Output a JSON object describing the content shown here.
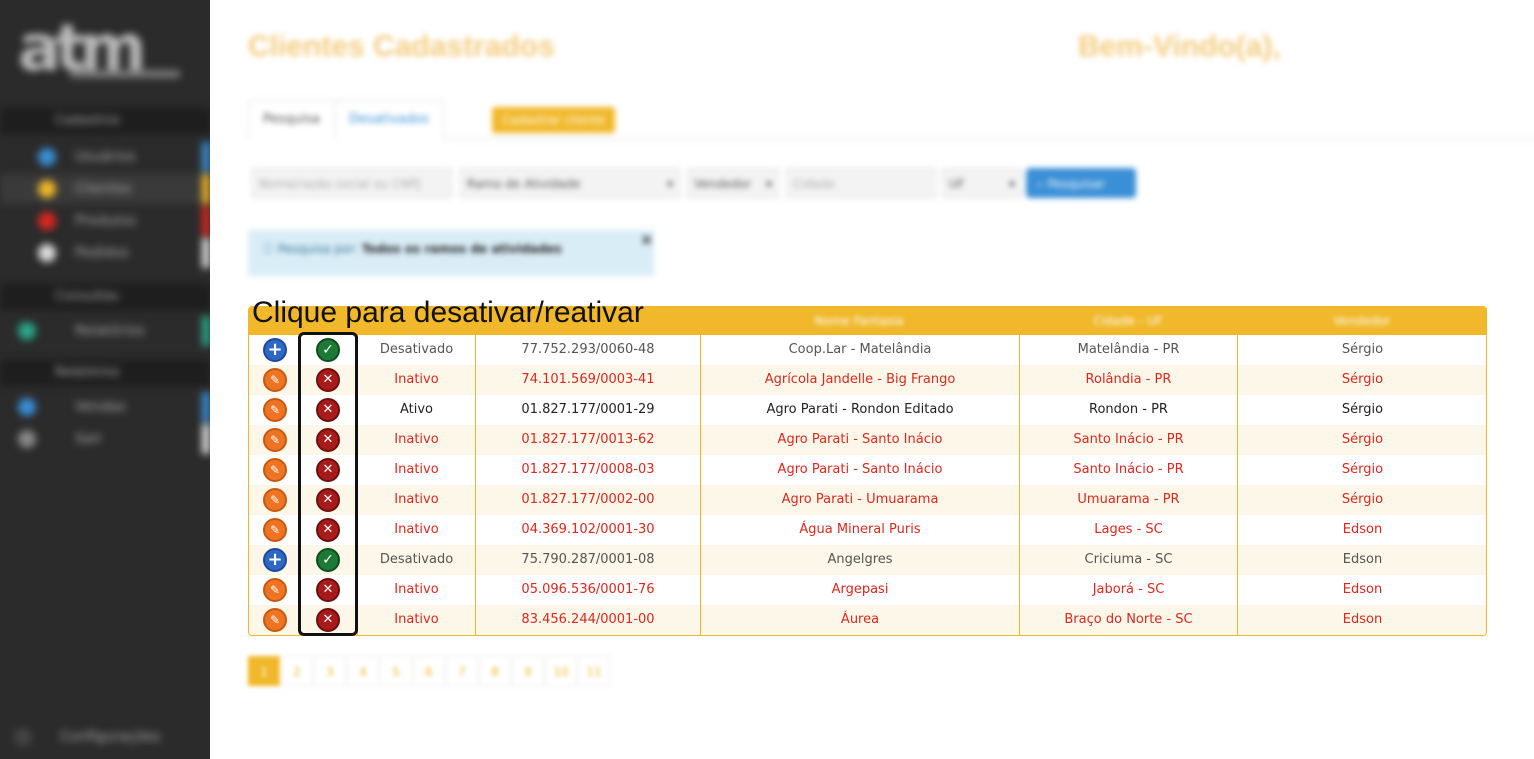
{
  "sidebar": {
    "logo": "atm",
    "sections": [
      "Cadastros",
      "Consultas",
      "Relatórios"
    ],
    "items": [
      {
        "label": "Usuários",
        "color": "#3a8fd6"
      },
      {
        "label": "Clientes",
        "color": "#f0b82a"
      },
      {
        "label": "Produtos",
        "color": "#d9281e"
      },
      {
        "label": "Pedidos",
        "color": "#dddddd"
      },
      {
        "label": "Relatórios",
        "color": "#2aa88a"
      },
      {
        "label": "Vendas",
        "color": "#3a8fd6"
      },
      {
        "label": "Sair",
        "color": "#888888"
      }
    ],
    "footer": "Configurações"
  },
  "header": {
    "title": "Clientes Cadastrados",
    "welcome": "Bem-Vindo(a),"
  },
  "tabs": {
    "search": "Pesquisa",
    "disabled": "Desativados",
    "register_button": "Cadastrar cliente"
  },
  "filters": {
    "name_placeholder": "Nome/razão social ou CNPJ",
    "activity": "Ramo de Atividade",
    "seller": "Vendedor",
    "city_placeholder": "Cidade",
    "uf": "UF",
    "search_button": "Pesquisar"
  },
  "alert": {
    "prefix": "Pesquisa por:",
    "text": "Todos os ramos de atividades",
    "close": "×"
  },
  "annotation": "Clique para desativar/reativar",
  "table": {
    "columns": [
      "Nome Fantasia",
      "Cidade - UF",
      "Vendedor"
    ],
    "rows": [
      {
        "action": "plus",
        "toggle": "check",
        "status": "Desativado",
        "cnpj": "77.752.293/0060-48",
        "name": "Coop.Lar - Matelândia",
        "city": "Matelândia - PR",
        "seller": "Sérgio",
        "tone": "gray"
      },
      {
        "action": "edit",
        "toggle": "x",
        "status": "Inativo",
        "cnpj": "74.101.569/0003-41",
        "name": "Agrícola Jandelle - Big Frango",
        "city": "Rolândia - PR",
        "seller": "Sérgio",
        "tone": "red"
      },
      {
        "action": "edit",
        "toggle": "x",
        "status": "Ativo",
        "cnpj": "01.827.177/0001-29",
        "name": "Agro Parati - Rondon Editado",
        "city": "Rondon - PR",
        "seller": "Sérgio",
        "tone": "dark"
      },
      {
        "action": "edit",
        "toggle": "x",
        "status": "Inativo",
        "cnpj": "01.827.177/0013-62",
        "name": "Agro Parati - Santo Inácio",
        "city": "Santo Inácio - PR",
        "seller": "Sérgio",
        "tone": "red"
      },
      {
        "action": "edit",
        "toggle": "x",
        "status": "Inativo",
        "cnpj": "01.827.177/0008-03",
        "name": "Agro Parati - Santo Inácio",
        "city": "Santo Inácio - PR",
        "seller": "Sérgio",
        "tone": "red"
      },
      {
        "action": "edit",
        "toggle": "x",
        "status": "Inativo",
        "cnpj": "01.827.177/0002-00",
        "name": "Agro Parati - Umuarama",
        "city": "Umuarama - PR",
        "seller": "Sérgio",
        "tone": "red"
      },
      {
        "action": "edit",
        "toggle": "x",
        "status": "Inativo",
        "cnpj": "04.369.102/0001-30",
        "name": "Água Mineral Puris",
        "city": "Lages - SC",
        "seller": "Edson",
        "tone": "red"
      },
      {
        "action": "plus",
        "toggle": "check",
        "status": "Desativado",
        "cnpj": "75.790.287/0001-08",
        "name": "Angelgres",
        "city": "Criciuma - SC",
        "seller": "Edson",
        "tone": "gray"
      },
      {
        "action": "edit",
        "toggle": "x",
        "status": "Inativo",
        "cnpj": "05.096.536/0001-76",
        "name": "Argepasi",
        "city": "Jaborá - SC",
        "seller": "Edson",
        "tone": "red"
      },
      {
        "action": "edit",
        "toggle": "x",
        "status": "Inativo",
        "cnpj": "83.456.244/0001-00",
        "name": "Áurea",
        "city": "Braço do Norte - SC",
        "seller": "Edson",
        "tone": "red"
      }
    ]
  },
  "pagination": [
    "1",
    "2",
    "3",
    "4",
    "5",
    "6",
    "7",
    "8",
    "9",
    "10",
    "11"
  ],
  "pagination_active": "1"
}
